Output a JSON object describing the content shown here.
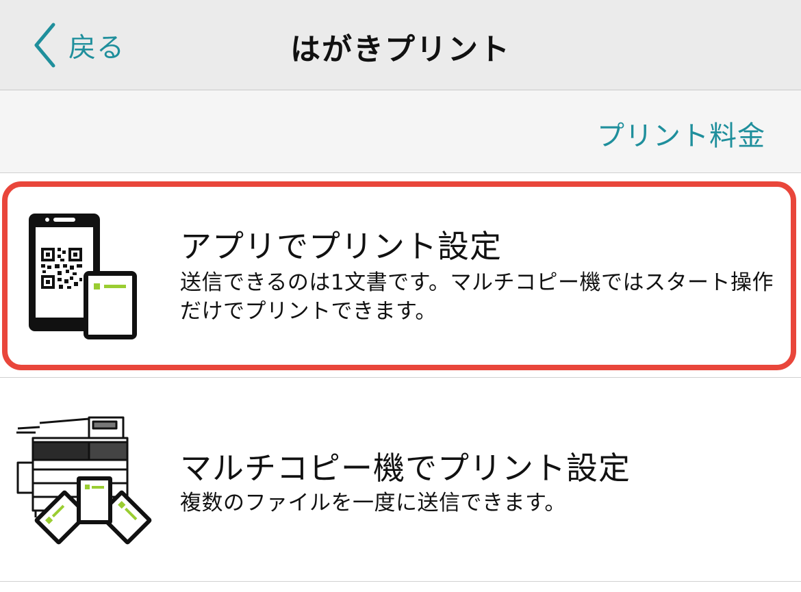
{
  "nav": {
    "back_label": "戻る",
    "title": "はがきプリント",
    "back_icon": "chevron-left-icon"
  },
  "subbar": {
    "fee_link": "プリント料金"
  },
  "options": [
    {
      "title": "アプリでプリント設定",
      "description": "送信できるのは1文書です。マルチコピー機ではスタート操作だけでプリントできます。",
      "icon": "smartphone-qr-icon",
      "highlighted": true
    },
    {
      "title": "マルチコピー機でプリント設定",
      "description": "複数のファイルを一度に送信できます。",
      "icon": "multifunction-copier-icon",
      "highlighted": false
    }
  ],
  "colors": {
    "accent": "#1f8f9c",
    "highlight_border": "#e9463b",
    "icon_green": "#9acd32",
    "nav_bg": "#ebebeb",
    "subbar_bg": "#f5f5f5"
  }
}
